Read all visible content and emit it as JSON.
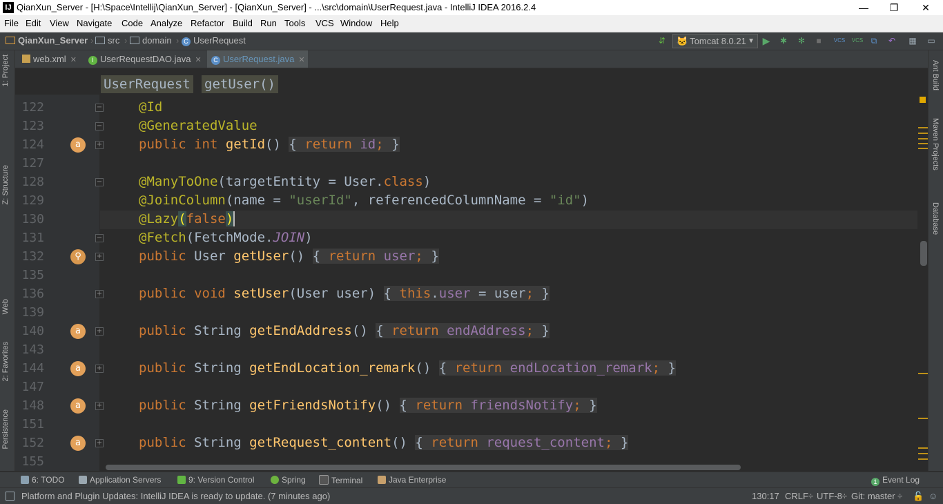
{
  "window": {
    "title": "QianXun_Server - [H:\\Space\\Intellij\\QianXun_Server] - [QianXun_Server] - ...\\src\\domain\\UserRequest.java - IntelliJ IDEA 2016.2.4",
    "minimize": "—",
    "restore": "❐",
    "close": "✕"
  },
  "menu": [
    "File",
    "Edit",
    "View",
    "Navigate",
    "Code",
    "Analyze",
    "Refactor",
    "Build",
    "Run",
    "Tools",
    "VCS",
    "Window",
    "Help"
  ],
  "nav": {
    "project": "QianXun_Server",
    "folder1": "src",
    "folder2": "domain",
    "file": "UserRequest",
    "run_config": "Tomcat 8.0.21"
  },
  "tabs": [
    {
      "label": "web.xml"
    },
    {
      "label": "UserRequestDAO.java"
    },
    {
      "label": "UserRequest.java"
    }
  ],
  "editor_breadcrumbs": [
    "UserRequest",
    "getUser()"
  ],
  "left_stripe": {
    "project": "1: Project",
    "structure": "Z: Structure",
    "web": "Web",
    "favorites": "2: Favorites",
    "persistence": "Persistence"
  },
  "right_stripe": {
    "ant": "Ant Build",
    "maven": "Maven Projects",
    "database": "Database"
  },
  "line_numbers": [
    "122",
    "123",
    "124",
    "127",
    "128",
    "129",
    "130",
    "131",
    "132",
    "135",
    "136",
    "139",
    "140",
    "143",
    "144",
    "147",
    "148",
    "151",
    "152",
    "155"
  ],
  "code": {
    "l122": "@Id",
    "l123": "@GeneratedValue",
    "l124": {
      "a": "public int ",
      "b": "getId",
      "c": "() ",
      "d": "{ ",
      "e": "return ",
      "f": "id",
      "g": "; ",
      "h": "}"
    },
    "l128": {
      "a": "@ManyToOne",
      "b": "(targetEntity = User.",
      "c": "class",
      "d": ")"
    },
    "l129": {
      "a": "@JoinColumn",
      "b": "(name = ",
      "c": "\"userId\"",
      "d": ", referencedColumnName = ",
      "e": "\"id\"",
      "f": ")"
    },
    "l130": {
      "a": "@Lazy",
      "b": "(",
      "c": "false",
      "d": ")"
    },
    "l131": {
      "a": "@Fetch",
      "b": "(FetchMode.",
      "c": "JOIN",
      "d": ")"
    },
    "l132": {
      "a": "public ",
      "b": "User ",
      "c": "getUser",
      "d": "() ",
      "e": "{ ",
      "f": "return ",
      "g": "user",
      "h": "; ",
      "i": "}"
    },
    "l136": {
      "a": "public void ",
      "b": "setUser",
      "c": "(User user) ",
      "d": "{ ",
      "e": "this",
      "f": ".",
      "g": "user",
      "h": " = user",
      "i": "; ",
      "j": "}"
    },
    "l140": {
      "a": "public ",
      "b": "String ",
      "c": "getEndAddress",
      "d": "() ",
      "e": "{ ",
      "f": "return ",
      "g": "endAddress",
      "h": "; ",
      "i": "}"
    },
    "l144": {
      "a": "public ",
      "b": "String ",
      "c": "getEndLocation_remark",
      "d": "() ",
      "e": "{ ",
      "f": "return ",
      "g": "endLocation_remark",
      "h": "; ",
      "i": "}"
    },
    "l148": {
      "a": "public ",
      "b": "String ",
      "c": "getFriendsNotify",
      "d": "() ",
      "e": "{ ",
      "f": "return ",
      "g": "friendsNotify",
      "h": "; ",
      "i": "}"
    },
    "l152": {
      "a": "public ",
      "b": "String ",
      "c": "getRequest_content",
      "d": "() ",
      "e": "{ ",
      "f": "return ",
      "g": "request_content",
      "h": "; ",
      "i": "}"
    }
  },
  "gutter_icon_letter": "a",
  "tool_windows": [
    "6: TODO",
    "Application Servers",
    "9: Version Control",
    "Spring",
    "Terminal",
    "Java Enterprise"
  ],
  "event_log": {
    "count": "1",
    "label": "Event Log"
  },
  "status": {
    "message": "Platform and Plugin Updates: IntelliJ IDEA is ready to update. (7 minutes ago)",
    "position": "130:17",
    "line_sep": "CRLF÷",
    "encoding": "UTF-8÷",
    "vcs": "Git: master ÷"
  }
}
